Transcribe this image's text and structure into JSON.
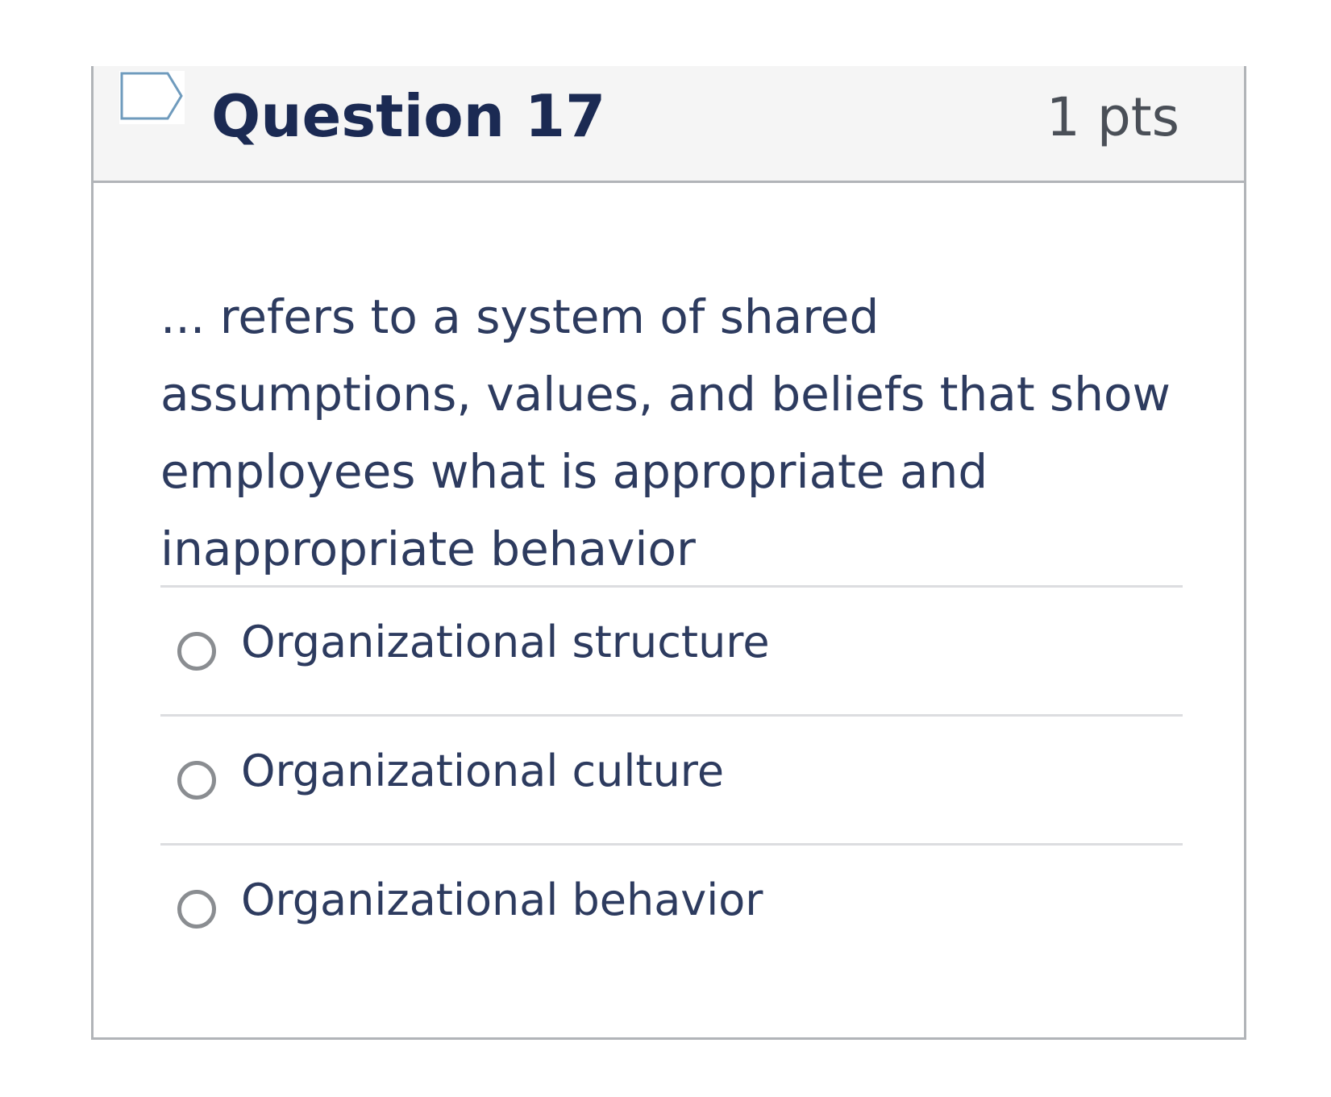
{
  "question": {
    "title": "Question 17",
    "points": "1 pts",
    "text": "... refers to a system of shared assumptions, values, and beliefs that show employees what is appropriate and inappropriate behavior",
    "flag_icon": "flag-outline-icon",
    "answers": [
      {
        "label": "Organizational structure",
        "selected": false
      },
      {
        "label": "Organizational culture",
        "selected": false
      },
      {
        "label": "Organizational behavior",
        "selected": false
      }
    ]
  },
  "colors": {
    "title": "#1b2a53",
    "text": "#2d3b5f",
    "border": "#b1b4b8",
    "header_bg": "#f5f5f5"
  }
}
